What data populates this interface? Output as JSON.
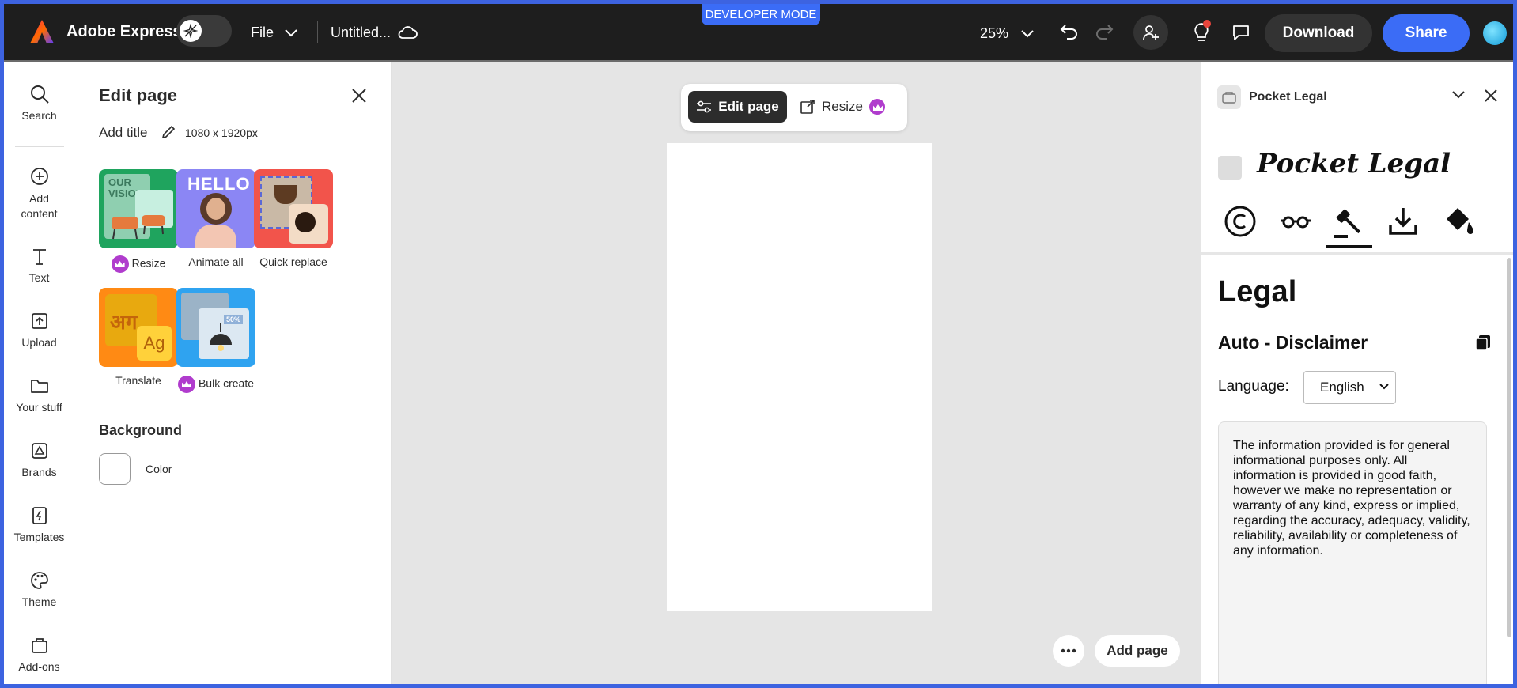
{
  "topbar": {
    "brand": "Adobe Express",
    "file_label": "File",
    "doc_title": "Untitled...",
    "dev_badge": "DEVELOPER MODE",
    "zoom": "25%",
    "download_label": "Download",
    "share_label": "Share"
  },
  "rail": {
    "items": [
      {
        "label": "Search",
        "icon": "search-icon"
      },
      {
        "label": "Add\ncontent",
        "icon": "plus-circle-icon"
      },
      {
        "label": "Text",
        "icon": "text-icon"
      },
      {
        "label": "Upload",
        "icon": "upload-icon"
      },
      {
        "label": "Your stuff",
        "icon": "folder-icon"
      },
      {
        "label": "Brands",
        "icon": "brand-icon"
      },
      {
        "label": "Templates",
        "icon": "templates-icon"
      },
      {
        "label": "Theme",
        "icon": "palette-icon"
      },
      {
        "label": "Add-ons",
        "icon": "addons-icon"
      }
    ]
  },
  "panel": {
    "title": "Edit page",
    "add_title": "Add title",
    "dims": "1080 x 1920px",
    "tiles": [
      {
        "label": "Resize",
        "premium": true
      },
      {
        "label": "Animate all",
        "premium": false
      },
      {
        "label": "Quick replace",
        "premium": false
      },
      {
        "label": "Translate",
        "premium": false
      },
      {
        "label": "Bulk create",
        "premium": true
      }
    ],
    "tile_text": {
      "resize_art": "OUR VISION",
      "animate_art": "HELLO",
      "translate_big": "अग",
      "translate_small": "Ag",
      "bulk_badge": "50%"
    },
    "background_title": "Background",
    "color_label": "Color"
  },
  "canvas": {
    "edit_page_label": "Edit page",
    "resize_label": "Resize",
    "add_page_label": "Add page"
  },
  "addon": {
    "name": "Pocket Legal",
    "logo_text": "Pocket Legal",
    "heading": "Legal",
    "subheading": "Auto - Disclaimer",
    "language_label": "Language:",
    "language_value": "English",
    "disclaimer": "The information provided is for general informational purposes only. All information is provided in good faith, however we make no representation or warranty of any kind, express or implied, regarding the accuracy, adequacy, validity, reliability, availability or completeness of any information.",
    "tabs": [
      "copyright-icon",
      "glasses-icon",
      "gavel-icon",
      "download-icon",
      "paint-bucket-icon"
    ]
  },
  "colors": {
    "accent": "#3b6cf6",
    "topbar": "#1e1e1e",
    "premium": "#b03ccd"
  }
}
